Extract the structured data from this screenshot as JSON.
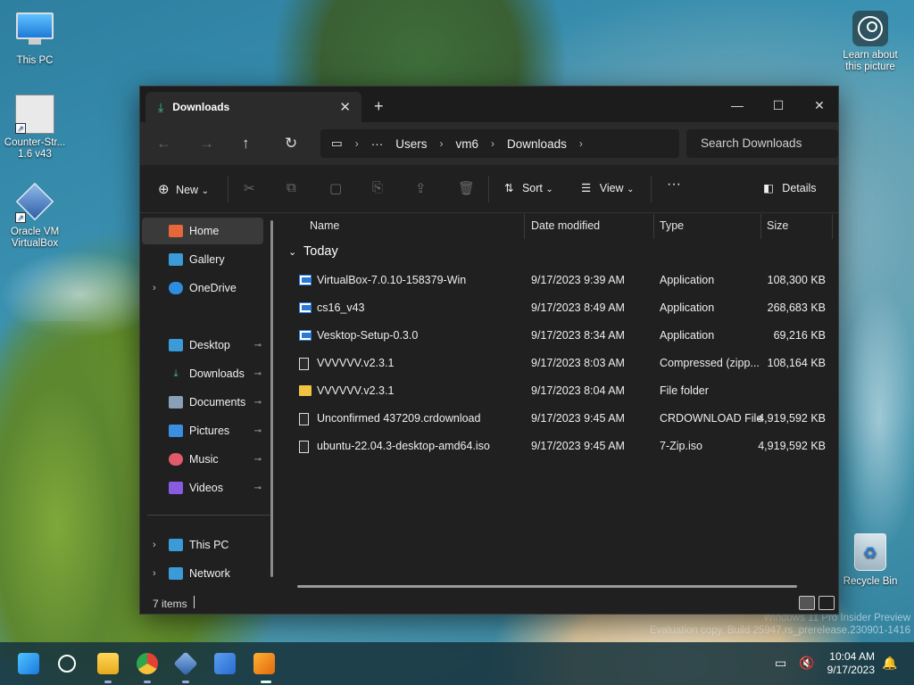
{
  "desktop": {
    "icons": [
      {
        "label": "This PC"
      },
      {
        "label": "Counter-Str... 1.6 v43"
      },
      {
        "label": "Oracle VM VirtualBox"
      },
      {
        "label": "Recycle Bin"
      },
      {
        "label": "Learn about this picture"
      }
    ],
    "watermark": {
      "line1": "Windows 11 Pro Insider Preview",
      "line2": "Evaluation copy. Build 25947.rs_prerelease.230901-1416"
    }
  },
  "window": {
    "tab_title": "Downloads",
    "tab_close": "✕",
    "new_tab": "+",
    "controls": {
      "minimize": "—",
      "maximize": "☐",
      "close": "✕"
    },
    "nav": {
      "back": "←",
      "forward": "→",
      "up": "↑",
      "refresh": "↻"
    },
    "address": {
      "computer_icon": "▭",
      "overflow": "···",
      "crumbs": [
        "Users",
        "vm6",
        "Downloads"
      ],
      "sep": "›"
    },
    "search_placeholder": "Search Downloads",
    "commandbar": {
      "new_label": "New",
      "new_icon": "⊕",
      "sort_label": "Sort",
      "view_label": "View",
      "more": "···",
      "details_label": "Details",
      "chevron": "⌄",
      "cut": "✂",
      "copy": "⧉",
      "paste": "▢",
      "rename": "⎘",
      "share": "⇪",
      "delete": "🗑"
    },
    "sidebar": {
      "items": [
        {
          "label": "Home",
          "icon": "home-icon",
          "color": "#e8673a"
        },
        {
          "label": "Gallery",
          "icon": "gallery-icon",
          "color": "#3a9bd8"
        },
        {
          "label": "OneDrive",
          "icon": "onedrive-icon",
          "color": "#2d8ee0"
        },
        {
          "label": "Desktop",
          "icon": "desktop-icon",
          "color": "#3a9bd8"
        },
        {
          "label": "Downloads",
          "icon": "downloads-icon",
          "color": "#3fc0a0"
        },
        {
          "label": "Documents",
          "icon": "documents-icon",
          "color": "#8aa0b8"
        },
        {
          "label": "Pictures",
          "icon": "pictures-icon",
          "color": "#3a8fe0"
        },
        {
          "label": "Music",
          "icon": "music-icon",
          "color": "#e05a6a"
        },
        {
          "label": "Videos",
          "icon": "videos-icon",
          "color": "#8a5ae0"
        },
        {
          "label": "This PC",
          "icon": "this-pc-icon",
          "color": "#3a9bd8"
        },
        {
          "label": "Network",
          "icon": "network-icon",
          "color": "#3a9bd8"
        }
      ],
      "expand": "›",
      "pin": "📌"
    },
    "columns": {
      "name": "Name",
      "date": "Date modified",
      "type": "Type",
      "size": "Size"
    },
    "group": "Today",
    "group_chevron": "⌄",
    "files": [
      {
        "name": "VirtualBox-7.0.10-158379-Win",
        "date": "9/17/2023 9:39 AM",
        "type": "Application",
        "size": "108,300 KB",
        "kind": "app"
      },
      {
        "name": "cs16_v43",
        "date": "9/17/2023 8:49 AM",
        "type": "Application",
        "size": "268,683 KB",
        "kind": "app"
      },
      {
        "name": "Vesktop-Setup-0.3.0",
        "date": "9/17/2023 8:34 AM",
        "type": "Application",
        "size": "69,216 KB",
        "kind": "app"
      },
      {
        "name": "VVVVVV.v2.3.1",
        "date": "9/17/2023 8:03 AM",
        "type": "Compressed (zipp...",
        "size": "108,164 KB",
        "kind": "doc"
      },
      {
        "name": "VVVVVV.v2.3.1",
        "date": "9/17/2023 8:04 AM",
        "type": "File folder",
        "size": "",
        "kind": "folder"
      },
      {
        "name": "Unconfirmed 437209.crdownload",
        "date": "9/17/2023 9:45 AM",
        "type": "CRDOWNLOAD File",
        "size": "4,919,592 KB",
        "kind": "doc"
      },
      {
        "name": "ubuntu-22.04.3-desktop-amd64.iso",
        "date": "9/17/2023 9:45 AM",
        "type": "7-Zip.iso",
        "size": "4,919,592 KB",
        "kind": "doc"
      }
    ],
    "status": {
      "count": "7 items"
    }
  },
  "taskbar": {
    "time": "10:04 AM",
    "date": "9/17/2023"
  }
}
